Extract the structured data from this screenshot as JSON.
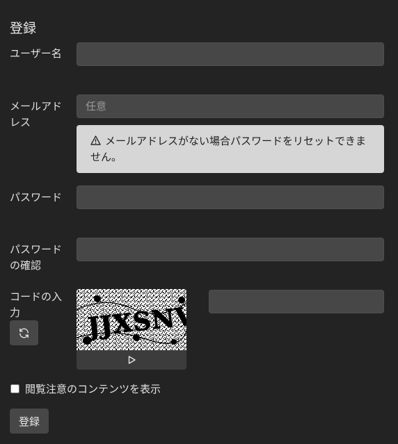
{
  "form": {
    "title": "登録",
    "username_label": "ユーザー名",
    "email_label": "メールアドレス",
    "email_placeholder": "任意",
    "email_warning": "メールアドレスがない場合パスワードをリセットできません。",
    "password_label": "パスワード",
    "password_confirm_label": "パスワードの確認",
    "captcha_label": "コードの入力",
    "captcha_code": "JJXSNV",
    "nsfw_label": "閲覧注意のコンテンツを表示",
    "submit_label": "登録"
  },
  "icons": {
    "warning": "warning-triangle-icon",
    "refresh": "refresh-icon",
    "play": "play-icon"
  },
  "colors": {
    "background": "#232323",
    "input_background": "#474747",
    "warning_background": "#d6d6d6"
  }
}
